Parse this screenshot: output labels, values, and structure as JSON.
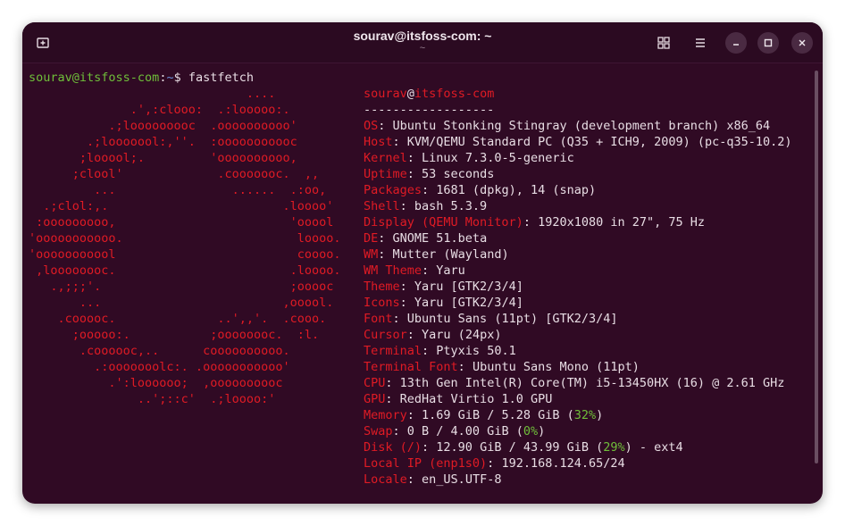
{
  "window": {
    "title": "sourav@itsfoss-com: ~",
    "subtitle": "~",
    "icons": {
      "new_tab": "new-tab-icon",
      "tabs_overview": "tabs-overview-icon",
      "menu": "hamburger-menu-icon",
      "minimize": "minimize-icon",
      "maximize": "maximize-icon",
      "close": "close-icon"
    }
  },
  "prompt": {
    "user_host": "sourav@itsfoss-com",
    "colon": ":",
    "dir": "~",
    "symbol": "$ ",
    "command": "fastfetch"
  },
  "logo_lines": [
    "                              ....",
    "              .',:clooo:  .:looooo:.",
    "           .;looooooooc  .oooooooooo'",
    "        .;looooool:,''.  :ooooooooooc",
    "       ;looool;.         'oooooooooo,",
    "      ;clool'             .cooooooc.  ,,",
    "         ...                ......  .:oo,",
    "  .;clol:,.                        .loooo'",
    " :ooooooooo,                        'ooool",
    "'ooooooooooo.                        loooo.",
    "'ooooooooool                         coooo.",
    " ,loooooooc.                        .loooo.",
    "   .,;;;'.                          ;ooooc",
    "       ...                         ,ooool.",
    "    .cooooc.              ..',,'.  .cooo.",
    "      ;ooooo:.           ;oooooooc.  :l.",
    "       .coooooc,..      coooooooooo.",
    "         .:ooooooolc:. .ooooooooooo'",
    "           .':loooooo;  ,oooooooooc",
    "               ..';::c'  .;loooo:'"
  ],
  "info": {
    "header_user": "sourav",
    "header_at": "@",
    "header_host": "itsfoss-com",
    "separator": "------------------",
    "rows": [
      {
        "key": "OS",
        "value": "Ubuntu Stonking Stingray (development branch) x86_64"
      },
      {
        "key": "Host",
        "value": "KVM/QEMU Standard PC (Q35 + ICH9, 2009) (pc-q35-10.2)"
      },
      {
        "key": "Kernel",
        "value": "Linux 7.3.0-5-generic"
      },
      {
        "key": "Uptime",
        "value": "53 seconds"
      },
      {
        "key": "Packages",
        "value": "1681 (dpkg), 14 (snap)"
      },
      {
        "key": "Shell",
        "value": "bash 5.3.9"
      },
      {
        "key": "Display (QEMU Monitor)",
        "value": "1920x1080 in 27\", 75 Hz"
      },
      {
        "key": "DE",
        "value": "GNOME 51.beta"
      },
      {
        "key": "WM",
        "value": "Mutter (Wayland)"
      },
      {
        "key": "WM Theme",
        "value": "Yaru"
      },
      {
        "key": "Theme",
        "value": "Yaru [GTK2/3/4]"
      },
      {
        "key": "Icons",
        "value": "Yaru [GTK2/3/4]"
      },
      {
        "key": "Font",
        "value": "Ubuntu Sans (11pt) [GTK2/3/4]"
      },
      {
        "key": "Cursor",
        "value": "Yaru (24px)"
      },
      {
        "key": "Terminal",
        "value": "Ptyxis 50.1"
      },
      {
        "key": "Terminal Font",
        "value": "Ubuntu Sans Mono (11pt)"
      },
      {
        "key": "CPU",
        "value": "13th Gen Intel(R) Core(TM) i5-13450HX (16) @ 2.61 GHz"
      },
      {
        "key": "GPU",
        "value": "RedHat Virtio 1.0 GPU"
      },
      {
        "key": "Memory",
        "value": "1.69 GiB / 5.28 GiB (",
        "pct": "32%",
        "tail": ")"
      },
      {
        "key": "Swap",
        "value": "0 B / 4.00 GiB (",
        "pct": "0%",
        "tail": ")"
      },
      {
        "key": "Disk (/)",
        "value": "12.90 GiB / 43.99 GiB (",
        "pct": "29%",
        "tail": ") - ext4"
      },
      {
        "key": "Local IP (enp1s0)",
        "value": "192.168.124.65/24"
      },
      {
        "key": "Locale",
        "value": "en_US.UTF-8"
      }
    ]
  },
  "colors": {
    "background": "#300a24",
    "accent_red": "#e01b24",
    "prompt_green": "#6fbf3a",
    "prompt_blue": "#6a8fd6"
  }
}
